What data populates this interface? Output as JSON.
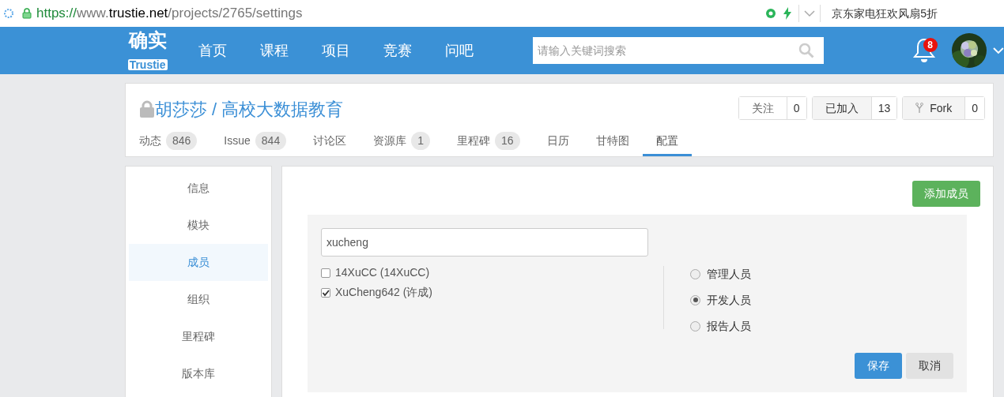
{
  "address_bar": {
    "url": {
      "scheme": "https://",
      "subdomain": "www.",
      "domain": "trustie.net",
      "path": "/projects/2765/settings"
    },
    "ad_text": "京东家电狂欢风扇5折"
  },
  "navbar": {
    "logo": {
      "top": "确实",
      "bottom": "Trustie"
    },
    "items": [
      {
        "label": "首页"
      },
      {
        "label": "课程"
      },
      {
        "label": "项目"
      },
      {
        "label": "竞赛"
      },
      {
        "label": "问吧"
      }
    ],
    "search": {
      "placeholder": "请输入关键词搜索"
    },
    "notifications": {
      "count": "8"
    }
  },
  "project": {
    "title": "胡莎莎 / 高校大数据教育",
    "private": true,
    "actions": [
      {
        "label": "关注",
        "count": "0",
        "kind": "plain"
      },
      {
        "label": "已加入",
        "count": "13",
        "kind": "pressed"
      },
      {
        "label": "Fork",
        "count": "0",
        "kind": "fork"
      }
    ],
    "tabs": [
      {
        "label": "动态",
        "count": "846",
        "selected": false
      },
      {
        "label": "Issue",
        "count": "844",
        "selected": false
      },
      {
        "label": "讨论区",
        "selected": false
      },
      {
        "label": "资源库",
        "count": "1",
        "selected": false
      },
      {
        "label": "里程碑",
        "count": "16",
        "selected": false
      },
      {
        "label": "日历",
        "selected": false
      },
      {
        "label": "甘特图",
        "selected": false
      },
      {
        "label": "配置",
        "selected": true
      }
    ]
  },
  "settings_menu": [
    {
      "label": "信息",
      "selected": false
    },
    {
      "label": "模块",
      "selected": false
    },
    {
      "label": "成员",
      "selected": true
    },
    {
      "label": "组织",
      "selected": false
    },
    {
      "label": "里程碑",
      "selected": false
    },
    {
      "label": "版本库",
      "selected": false
    }
  ],
  "members": {
    "add_button": "添加成员",
    "search_value": "xucheng",
    "users": [
      {
        "label": "14XuCC (14XuCC)",
        "checked": false
      },
      {
        "label": "XuCheng642 (许成)",
        "checked": true
      }
    ],
    "roles": [
      {
        "label": "管理人员",
        "selected": false
      },
      {
        "label": "开发人员",
        "selected": true
      },
      {
        "label": "报告人员",
        "selected": false
      }
    ],
    "save_button": "保存",
    "cancel_button": "取消"
  }
}
